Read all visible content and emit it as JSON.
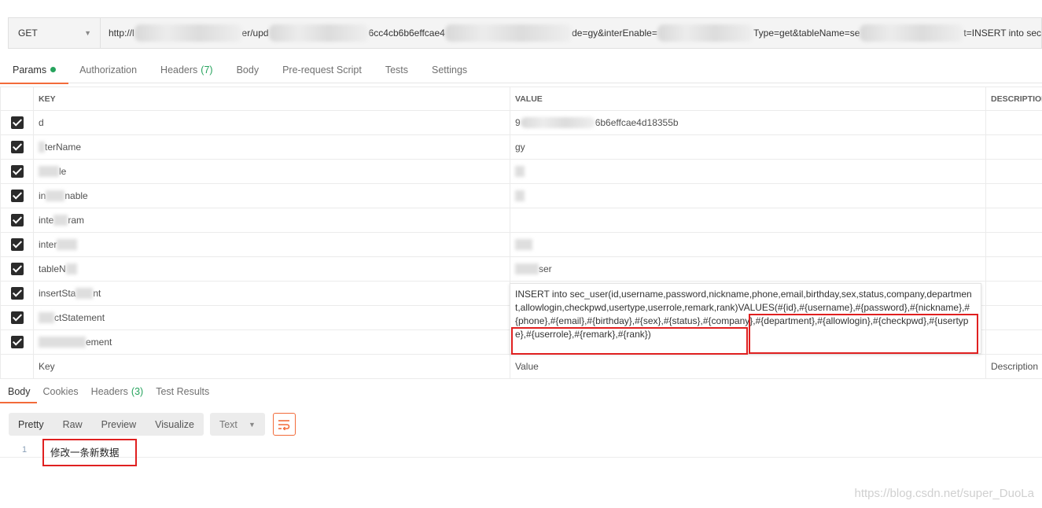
{
  "request": {
    "method": "GET",
    "url_parts": [
      "http://l",
      "er/upd",
      "6cc4cb6b6effcae4",
      "de=gy&interEnable=",
      "Type=get&tableName=se",
      "t=INSERT into sec"
    ]
  },
  "tabs": [
    {
      "label": "Params",
      "count": ""
    },
    {
      "label": "Authorization",
      "count": ""
    },
    {
      "label": "Headers",
      "count": "(7)"
    },
    {
      "label": "Body",
      "count": ""
    },
    {
      "label": "Pre-request Script",
      "count": ""
    },
    {
      "label": "Tests",
      "count": ""
    },
    {
      "label": "Settings",
      "count": ""
    }
  ],
  "params": {
    "headers": {
      "key": "KEY",
      "value": "VALUE",
      "description": "DESCRIPTION"
    },
    "rows": [
      {
        "key": "d",
        "value": "9",
        "value_tail": "6b6effcae4d18355b"
      },
      {
        "key": "terName",
        "value": "gy",
        "value_tail": ""
      },
      {
        "key": "le",
        "value": "",
        "value_tail": ""
      },
      {
        "key": "in",
        "key_tail": "nable",
        "value": "",
        "value_tail": ""
      },
      {
        "key": "inte",
        "key_tail": "ram",
        "value": "",
        "value_tail": ""
      },
      {
        "key": "inter",
        "value": "",
        "value_tail": ""
      },
      {
        "key": "tableN",
        "value": "",
        "value_tail": "ser"
      },
      {
        "key": "insertSta",
        "key_tail": "nt",
        "value": "",
        "value_tail": ""
      },
      {
        "key": "",
        "key_tail": "ctStatement",
        "value": "",
        "value_tail": ""
      },
      {
        "key": "",
        "key_tail": "ement",
        "value": "",
        "value_tail": ""
      }
    ],
    "new_row": {
      "key_placeholder": "Key",
      "value_placeholder": "Value",
      "description_placeholder": "Description"
    }
  },
  "editor": {
    "text": "INSERT into sec_user(id,username,password,nickname,phone,email,birthday,sex,status,company,department,allowlogin,checkpwd,usertype,userrole,remark,rank)VALUES(#{id},#{username},#{password},#{nickname},#{phone},#{email},#{birthday},#{sex},#{status},#{company},#{department},#{allowlogin},#{checkpwd},#{usertype},#{userrole},#{remark},#{rank})"
  },
  "response": {
    "tabs": [
      {
        "label": "Body",
        "count": ""
      },
      {
        "label": "Cookies",
        "count": ""
      },
      {
        "label": "Headers",
        "count": "(3)"
      },
      {
        "label": "Test Results",
        "count": ""
      }
    ],
    "views": [
      "Pretty",
      "Raw",
      "Preview",
      "Visualize"
    ],
    "format": "Text",
    "line_number": "1",
    "body_text": "修改一条新数据"
  },
  "watermark": "https://blog.csdn.net/super_DuoLa",
  "colors": {
    "accent": "#f26b3a",
    "count_green": "#26a35d",
    "highlight_red": "#e02020"
  },
  "icons": [
    "chevron-down-icon",
    "checkbox-checked-icon",
    "wrap-lines-icon"
  ]
}
